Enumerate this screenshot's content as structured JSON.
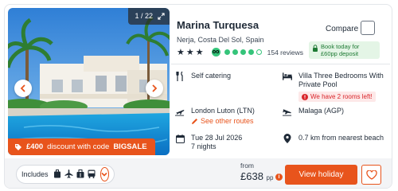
{
  "photo": {
    "counter": "1 / 22",
    "discount_amount": "£400",
    "discount_text": "discount with code",
    "discount_code": "BIGSALE"
  },
  "header": {
    "hotel_name": "Marina Turquesa",
    "location": "Nerja, Costa Del Sol, Spain",
    "star_rating": 3,
    "tripadvisor_rating": 4,
    "reviews": "154 reviews",
    "compare_label": "Compare",
    "deposit_text": "Book today for £60pp deposit"
  },
  "details": {
    "board": "Self catering",
    "room": "Villa Three Bedrooms With Private Pool",
    "rooms_left": "We have 2 rooms left!",
    "departure": "London Luton (LTN)",
    "other_routes": "See other routes",
    "arrival": "Malaga (AGP)",
    "date": "Tue 28 Jul 2026",
    "nights": "7 nights",
    "distance": "0.7 km from nearest beach"
  },
  "footer": {
    "includes_label": "Includes",
    "from_label": "from",
    "price": "£638",
    "pp": "pp",
    "view_button": "View holiday"
  },
  "colors": {
    "accent": "#e8541c",
    "deposit_bg": "#e4f5e6",
    "deposit_text": "#1e7a34",
    "alert_red": "#d9252a",
    "tripadvisor_green": "#35c47a"
  }
}
